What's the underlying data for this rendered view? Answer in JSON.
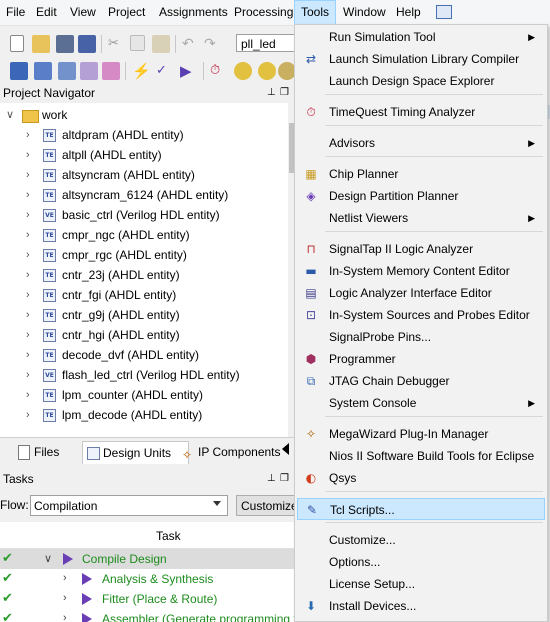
{
  "menubar": [
    "File",
    "Edit",
    "View",
    "Project",
    "Assignments",
    "Processing",
    "Tools",
    "Window",
    "Help"
  ],
  "toolbar": {
    "project_combo": "pll_led"
  },
  "navigator": {
    "title": "Project Navigator",
    "folder": "work",
    "entities": [
      "altdpram (AHDL entity)",
      "altpll (AHDL entity)",
      "altsyncram (AHDL entity)",
      "altsyncram_6124 (AHDL entity)",
      "basic_ctrl (Verilog HDL entity)",
      "cmpr_ngc (AHDL entity)",
      "cmpr_rgc (AHDL entity)",
      "cntr_23j (AHDL entity)",
      "cntr_fgi (AHDL entity)",
      "cntr_g9j (AHDL entity)",
      "cntr_hgi (AHDL entity)",
      "decode_dvf (AHDL entity)",
      "flash_led_ctrl (Verilog HDL entity)",
      "lpm_counter (AHDL entity)",
      "lpm_decode (AHDL entity)"
    ],
    "entity_icons": [
      "TE",
      "TE",
      "TE",
      "TE",
      "VE",
      "TE",
      "TE",
      "TE",
      "TE",
      "TE",
      "TE",
      "TE",
      "VE",
      "TE",
      "TE"
    ]
  },
  "tabs": [
    "Files",
    "Design Units",
    "IP Components"
  ],
  "tasks": {
    "title": "Tasks",
    "flow_label": "Flow:",
    "flow_value": "Compilation",
    "customize_label": "Customize...",
    "column_header": "Task",
    "items": [
      "Compile Design",
      "Analysis & Synthesis",
      "Fitter (Place & Route)",
      "Assembler (Generate programming files)"
    ]
  },
  "tools_menu": [
    {
      "label": "Run Simulation Tool",
      "submenu": true,
      "icon": "none"
    },
    {
      "label": "Launch Simulation Library Compiler",
      "submenu": false,
      "icon": "sim-compiler-icon"
    },
    {
      "label": "Launch Design Space Explorer",
      "submenu": false,
      "icon": "none"
    },
    {
      "label": "TimeQuest Timing Analyzer",
      "submenu": false,
      "icon": "stopwatch-icon"
    },
    {
      "label": "Advisors",
      "submenu": true,
      "icon": "none"
    },
    {
      "label": "Chip Planner",
      "submenu": false,
      "icon": "chip-planner-icon"
    },
    {
      "label": "Design Partition Planner",
      "submenu": false,
      "icon": "partition-icon"
    },
    {
      "label": "Netlist Viewers",
      "submenu": true,
      "icon": "none"
    },
    {
      "label": "SignalTap II Logic Analyzer",
      "submenu": false,
      "icon": "signaltap-icon"
    },
    {
      "label": "In-System Memory Content Editor",
      "submenu": false,
      "icon": "memory-icon"
    },
    {
      "label": "Logic Analyzer Interface Editor",
      "submenu": false,
      "icon": "la-interface-icon"
    },
    {
      "label": "In-System Sources and Probes Editor",
      "submenu": false,
      "icon": "probes-icon"
    },
    {
      "label": "SignalProbe Pins...",
      "submenu": false,
      "icon": "none"
    },
    {
      "label": "Programmer",
      "submenu": false,
      "icon": "programmer-icon"
    },
    {
      "label": "JTAG Chain Debugger",
      "submenu": false,
      "icon": "jtag-icon"
    },
    {
      "label": "System Console",
      "submenu": true,
      "icon": "none"
    },
    {
      "label": "MegaWizard Plug-In Manager",
      "submenu": false,
      "icon": "wand-icon"
    },
    {
      "label": "Nios II Software Build Tools for Eclipse",
      "submenu": false,
      "icon": "none"
    },
    {
      "label": "Qsys",
      "submenu": false,
      "icon": "qsys-icon"
    },
    {
      "label": "Tcl Scripts...",
      "submenu": false,
      "icon": "tcl-icon"
    },
    {
      "label": "Customize...",
      "submenu": false,
      "icon": "none"
    },
    {
      "label": "Options...",
      "submenu": false,
      "icon": "none"
    },
    {
      "label": "License Setup...",
      "submenu": false,
      "icon": "none"
    },
    {
      "label": "Install Devices...",
      "submenu": false,
      "icon": "install-icon"
    }
  ],
  "colors": {
    "highlight": "#cce8ff",
    "task_green": "#1e8c1e",
    "flow_purple": "#6a3fb5"
  }
}
